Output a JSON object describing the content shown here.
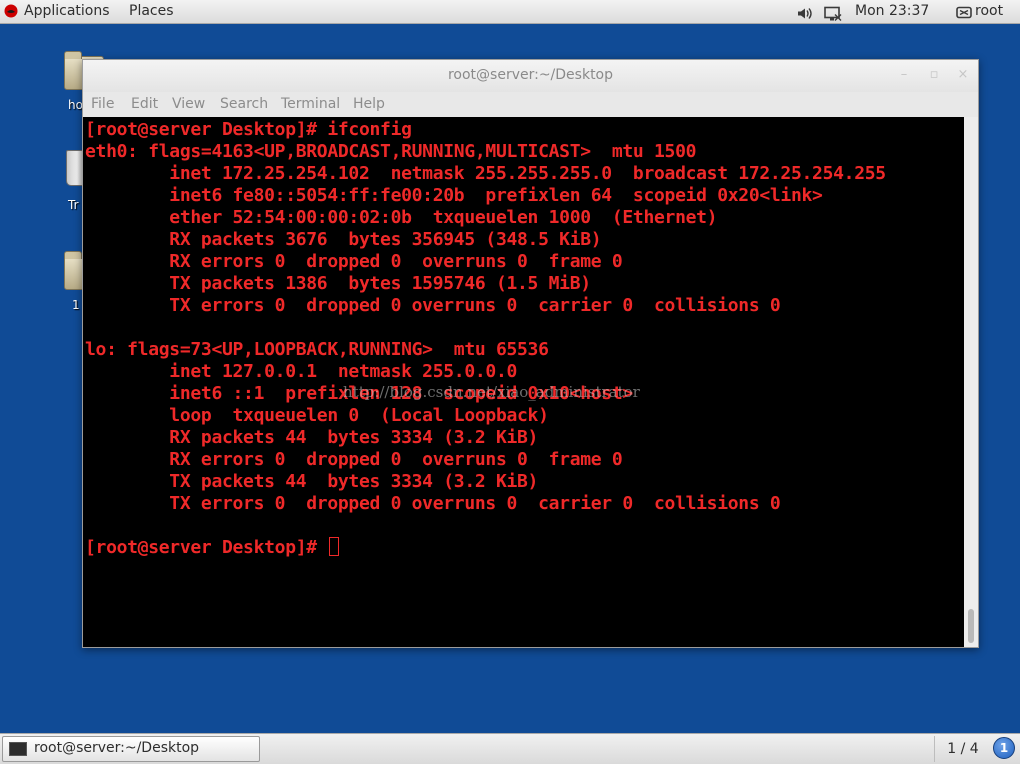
{
  "top_panel": {
    "applications_label": "Applications",
    "places_label": "Places",
    "clock": "Mon 23:37",
    "user": "root",
    "icons": [
      "redhat-logo-icon",
      "sound-icon",
      "network-icon",
      "user-icon"
    ]
  },
  "desktop": {
    "icons": [
      {
        "label": "ho",
        "icon": "home-folder-icon"
      },
      {
        "label": "Tr",
        "icon": "trash-icon"
      },
      {
        "label": "1",
        "icon": "folder-icon"
      }
    ]
  },
  "window": {
    "title": "root@server:~/Desktop",
    "controls": {
      "minimize": "–",
      "maximize": "▫",
      "close": "×"
    },
    "menu": [
      "File",
      "Edit",
      "View",
      "Search",
      "Terminal",
      "Help"
    ]
  },
  "terminal": {
    "text_color": "#ef2929",
    "background": "#000000",
    "lines": [
      "[root@server Desktop]# ifconfig",
      "eth0: flags=4163<UP,BROADCAST,RUNNING,MULTICAST>  mtu 1500",
      "        inet 172.25.254.102  netmask 255.255.255.0  broadcast 172.25.254.255",
      "        inet6 fe80::5054:ff:fe00:20b  prefixlen 64  scopeid 0x20<link>",
      "        ether 52:54:00:00:02:0b  txqueuelen 1000  (Ethernet)",
      "        RX packets 3676  bytes 356945 (348.5 KiB)",
      "        RX errors 0  dropped 0  overruns 0  frame 0",
      "        TX packets 1386  bytes 1595746 (1.5 MiB)",
      "        TX errors 0  dropped 0 overruns 0  carrier 0  collisions 0",
      "",
      "lo: flags=73<UP,LOOPBACK,RUNNING>  mtu 65536",
      "        inet 127.0.0.1  netmask 255.0.0.0",
      "        inet6 ::1  prefixlen 128  scopeid 0x10<host>",
      "        loop  txqueuelen 0  (Local Loopback)",
      "        RX packets 44  bytes 3334 (3.2 KiB)",
      "        RX errors 0  dropped 0  overruns 0  frame 0",
      "        TX packets 44  bytes 3334 (3.2 KiB)",
      "        TX errors 0  dropped 0 overruns 0  carrier 0  collisions 0",
      "",
      "[root@server Desktop]# "
    ],
    "watermark": "http://blog.csdn.net/xiao_administrator"
  },
  "taskbar": {
    "task_label": "root@server:~/Desktop",
    "workspace": "1 / 4",
    "indicator": "1"
  }
}
